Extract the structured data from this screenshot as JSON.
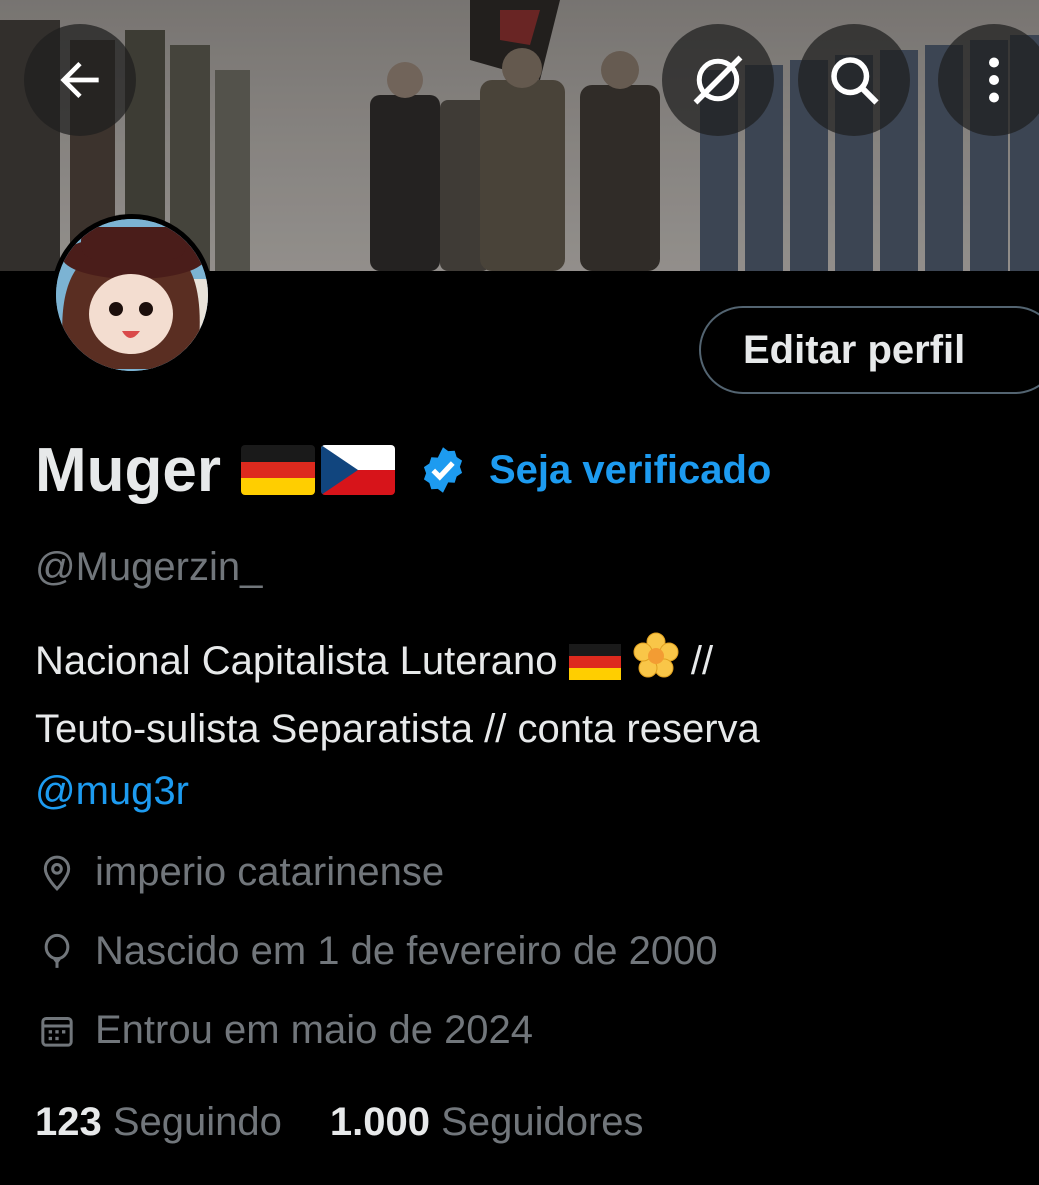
{
  "header": {
    "back_icon": "arrow-left-icon",
    "grok_icon": "grok-icon",
    "search_icon": "search-icon",
    "more_icon": "more-vertical-icon"
  },
  "profile": {
    "name": "Muger",
    "name_flags": [
      "Germany flag",
      "Czech Republic flag"
    ],
    "verify_label": "Seja verificado",
    "handle": "@Mugerzin_",
    "edit_label": "Editar perfil",
    "bio_line1_text": "Nacional Capitalista Luterano",
    "bio_line1_suffix": "//",
    "bio_line2": "Teuto-sulista Separatista // conta reserva",
    "bio_mention": "@mug3r",
    "location": "imperio catarinense",
    "birthday": "Nascido em 1 de fevereiro de 2000",
    "joined": "Entrou em maio de 2024",
    "following_count": "123",
    "following_label": "Seguindo",
    "followers_count": "1.000",
    "followers_label": "Seguidores"
  },
  "colors": {
    "background": "#000000",
    "text": "#e7e9ea",
    "muted": "#71767b",
    "accent": "#1d9bf0"
  }
}
